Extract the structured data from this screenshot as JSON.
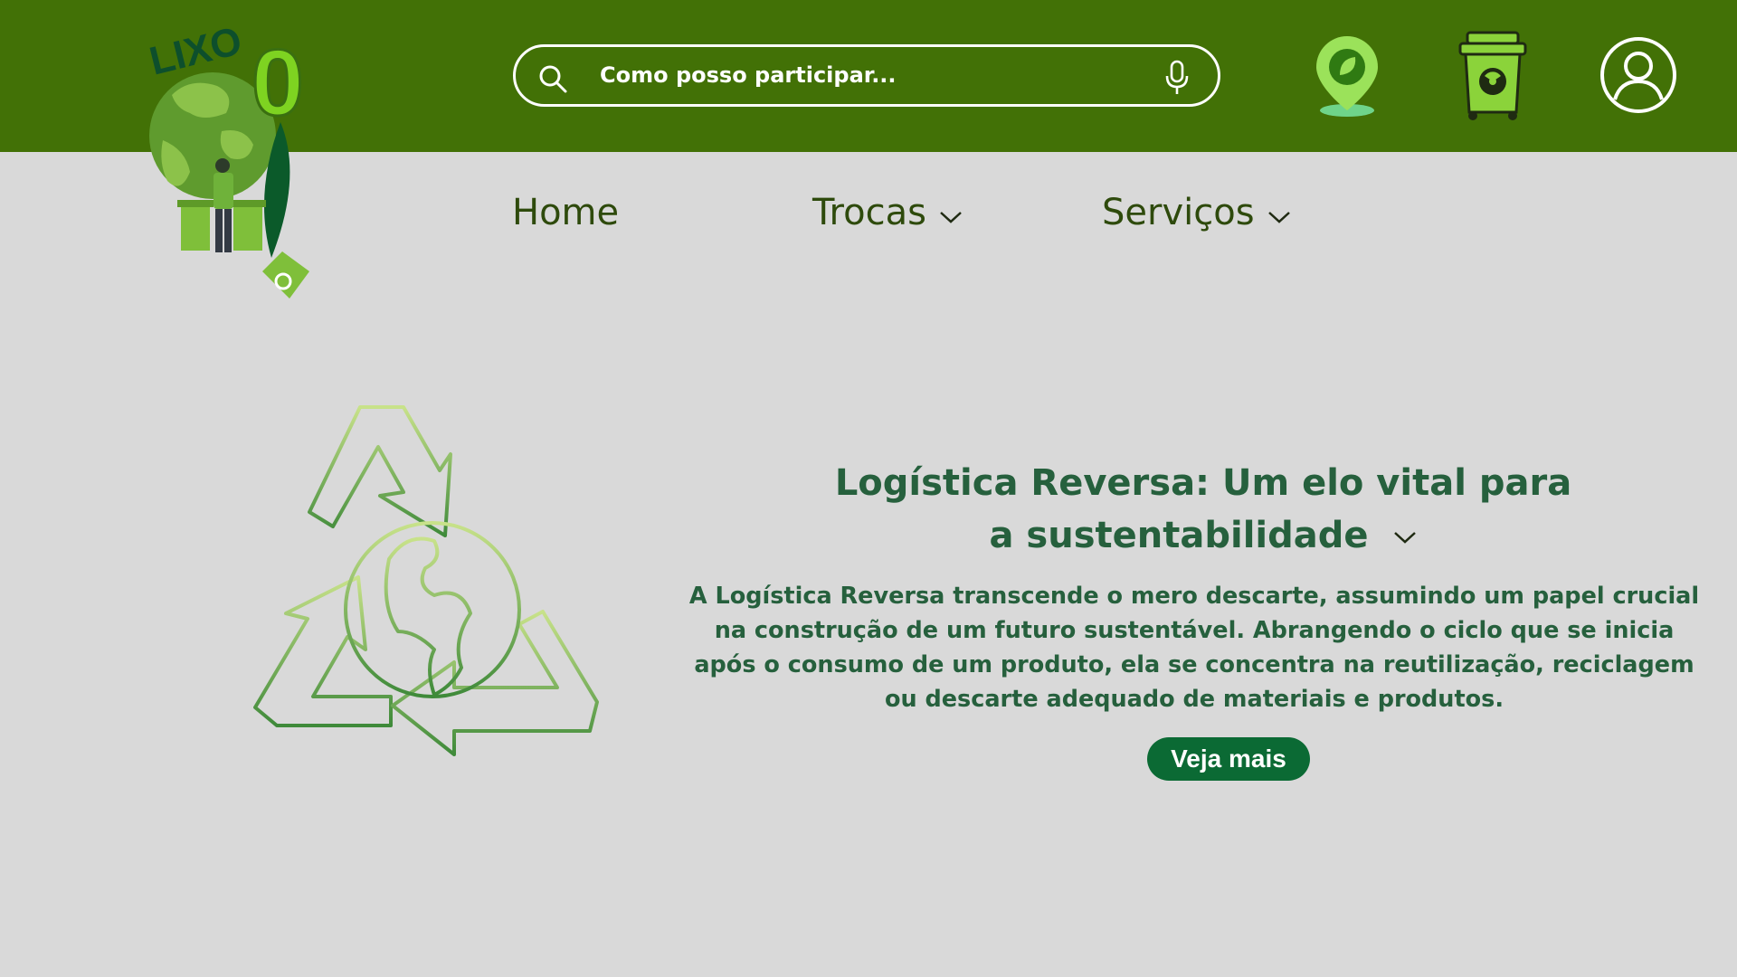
{
  "brand": {
    "logo_text": "LIXO",
    "logo_number": "0",
    "logo_name": "lixo-zero-logo"
  },
  "search": {
    "placeholder": "Como posso participar...",
    "icon": "search-icon",
    "voice_icon": "mic-icon"
  },
  "header_actions": [
    {
      "name": "map-pin-leaf-icon",
      "color": "#9be25a"
    },
    {
      "name": "hazard-bin-icon",
      "color": "#8bd33a"
    },
    {
      "name": "user-account-icon",
      "color": "#ffffff"
    }
  ],
  "nav": {
    "items": [
      {
        "label": "Home",
        "has_dropdown": false
      },
      {
        "label": "Trocas",
        "has_dropdown": true
      },
      {
        "label": "Serviços",
        "has_dropdown": true
      }
    ]
  },
  "hero": {
    "title_line1": "Logística Reversa: Um elo vital para",
    "title_line2": "a sustentabilidade",
    "body": "A Logística Reversa transcende o mero descarte, assumindo um papel crucial na construção de um futuro sustentável. Abrangendo o ciclo que se inicia após o consumo de um produto, ela se concentra na reutilização, reciclagem ou descarte adequado de materiais e produtos.",
    "cta_label": "Veja mais",
    "illustration": "recycle-globe-icon"
  },
  "colors": {
    "header_bg": "#427106",
    "page_bg": "#d9d9d9",
    "text_green": "#26603d",
    "nav_text": "#2e4a0c",
    "button_bg": "#0b6a34"
  }
}
